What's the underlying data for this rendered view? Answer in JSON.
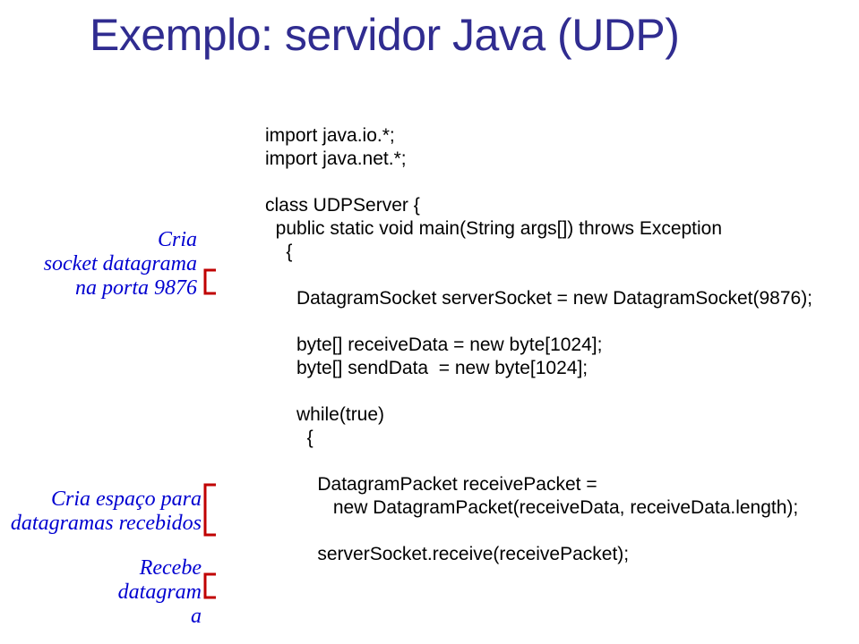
{
  "title": "Exemplo: servidor Java  (UDP)",
  "anno1": {
    "l1": "Cria",
    "l2": "socket datagrama",
    "l3": "na porta 9876"
  },
  "anno2": {
    "l1": "Cria espaço para",
    "l2": "datagramas recebidos"
  },
  "anno3": {
    "l1": "Recebe",
    "l2": "datagram",
    "l3": "a"
  },
  "code": {
    "c1": "import java.io.*;",
    "c2": "import java.net.*;",
    "c3": "class UDPServer {",
    "c4": "  public static void main(String args[]) throws Exception",
    "c5": "    {",
    "c6": "      DatagramSocket serverSocket = new DatagramSocket(9876);",
    "c7": "      byte[] receiveData = new byte[1024];",
    "c8": "      byte[] sendData  = new byte[1024];",
    "c9": "      while(true)",
    "c10": "        {",
    "c11": "          DatagramPacket receivePacket =",
    "c12": "             new DatagramPacket(receiveData, receiveData.length);",
    "c13": "          serverSocket.receive(receivePacket);"
  }
}
